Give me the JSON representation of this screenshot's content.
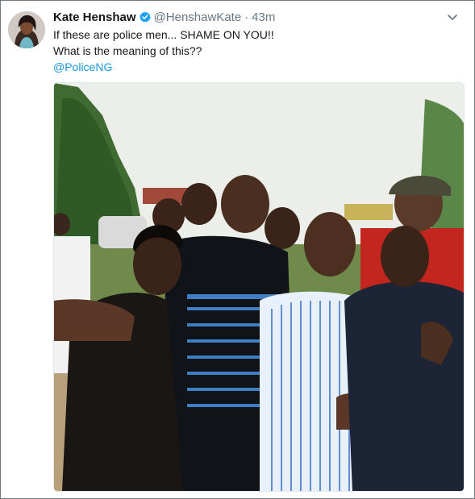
{
  "tweet": {
    "author_name": "Kate Henshaw",
    "handle": "@HenshawKate",
    "separator": "·",
    "time": "43m",
    "lines": [
      "If these are police men... SHAME ON YOU!!",
      "What is the meaning of this??"
    ],
    "mention": "@PoliceNG"
  },
  "colors": {
    "link": "#1b95e0",
    "verified": "#1da1f2",
    "secondary_text": "#657786"
  },
  "icons": {
    "verified": "verified-badge-icon",
    "menu": "chevron-down-icon"
  }
}
